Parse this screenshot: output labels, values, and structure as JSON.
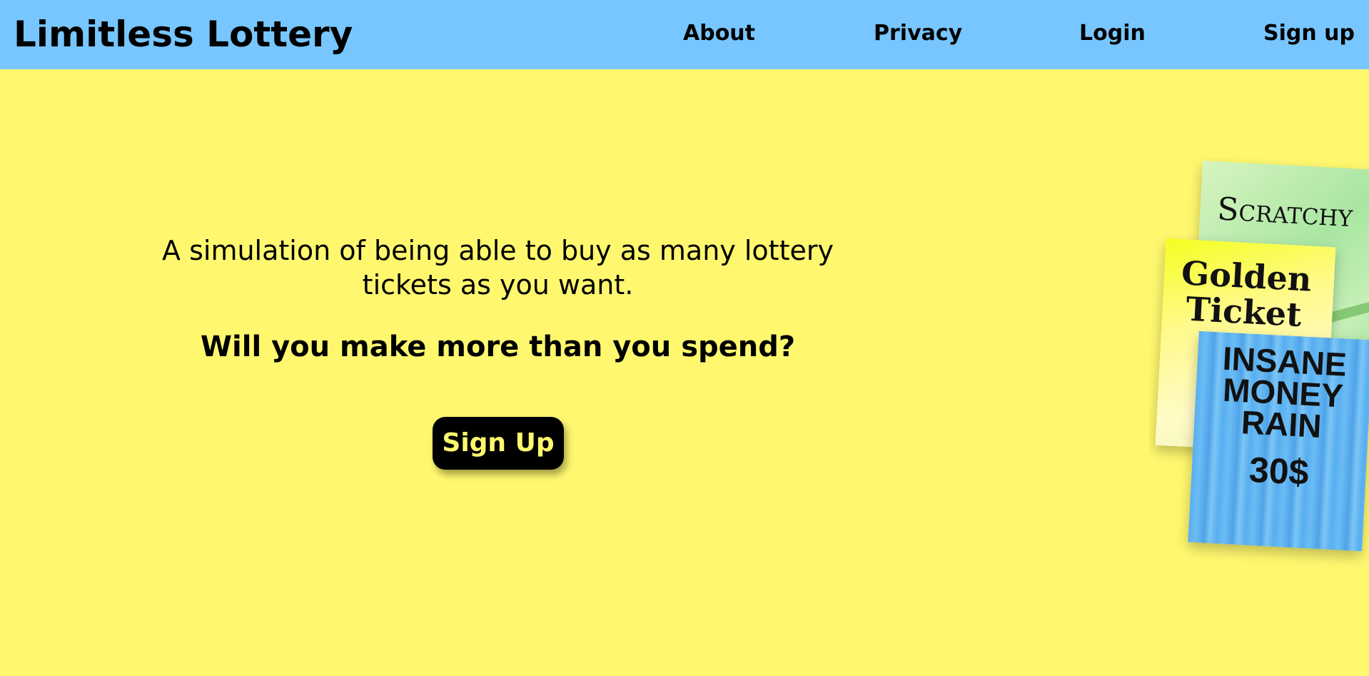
{
  "header": {
    "brand": "Limitless Lottery",
    "nav": {
      "about": "About",
      "privacy": "Privacy",
      "login": "Login",
      "signup": "Sign up"
    }
  },
  "hero": {
    "tagline": "A simulation of being able to buy as many lottery tickets as you want.",
    "question": "Will you make more than you spend?",
    "signup_button": "Sign Up"
  },
  "tickets": [
    {
      "name": "Scratchy"
    },
    {
      "name": "Golden Ticket"
    },
    {
      "name": "INSANE MONEY RAIN",
      "price": "30$"
    }
  ],
  "colors": {
    "header_bg": "#78c6ff",
    "page_bg": "#fff86f",
    "button_bg": "#000000",
    "button_text": "#fff86f"
  }
}
